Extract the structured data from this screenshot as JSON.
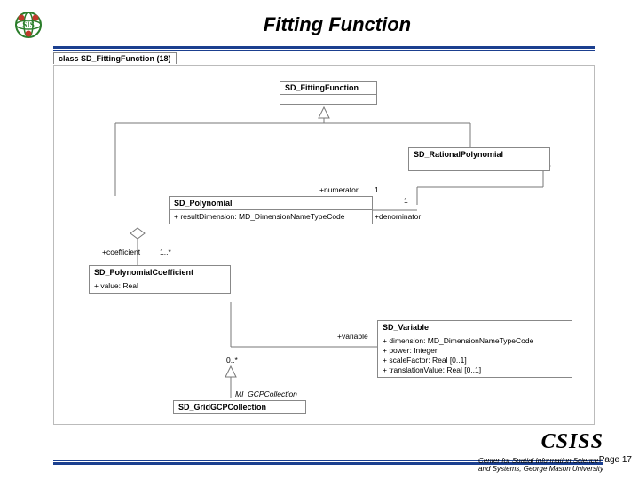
{
  "header": {
    "title": "Fitting Function",
    "logo_alt": "SIS Globe Logo"
  },
  "diagram": {
    "frame_label": "class SD_FittingFunction (18)",
    "classes": {
      "fitting_function": {
        "name": "SD_FittingFunction"
      },
      "rational_polynomial": {
        "name": "SD_RationalPolynomial"
      },
      "polynomial": {
        "name": "SD_Polynomial",
        "attrs": "+  resultDimension: MD_DimensionNameTypeCode"
      },
      "polynomial_coefficient": {
        "name": "SD_PolynomialCoefficient",
        "attrs": "+  value: Real"
      },
      "variable": {
        "name": "SD_Variable",
        "attrs": "+  dimension: MD_DimensionNameTypeCode\n+  power: Integer\n+  scaleFactor: Real [0..1]\n+  translationValue: Real [0..1]"
      },
      "grid_gcp": {
        "name": "SD_GridGCPCollection"
      },
      "mi_gcp": {
        "name": "MI_GCPCollection"
      }
    },
    "labels": {
      "numerator": "+numerator",
      "denominator": "+denominator",
      "one_a": "1",
      "one_b": "1",
      "coefficient": "+coefficient",
      "coef_mult": "1..*",
      "variable": "+variable",
      "var_mult": "0..*"
    }
  },
  "footer": {
    "org": "CSISS",
    "sub1": "Center for Spatial Information Science",
    "sub2": "and Systems, George Mason University",
    "page_label": "Page  17"
  }
}
